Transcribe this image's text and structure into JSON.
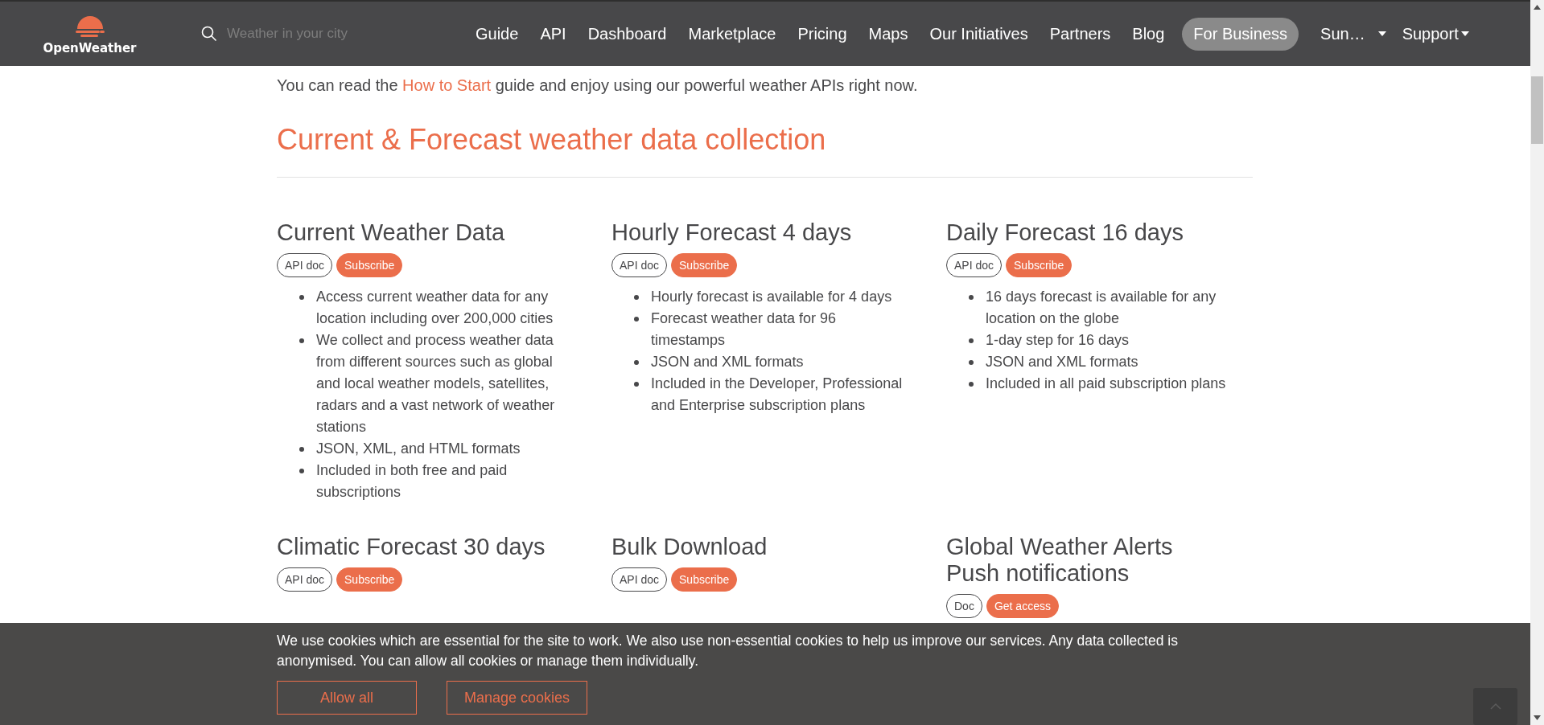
{
  "header": {
    "logo_text": "OpenWeather",
    "search": {
      "placeholder": "Weather in your city"
    },
    "nav": [
      {
        "label": "Guide",
        "kind": "link"
      },
      {
        "label": "API",
        "kind": "link"
      },
      {
        "label": "Dashboard",
        "kind": "link"
      },
      {
        "label": "Marketplace",
        "kind": "link"
      },
      {
        "label": "Pricing",
        "kind": "link"
      },
      {
        "label": "Maps",
        "kind": "link"
      },
      {
        "label": "Our Initiatives",
        "kind": "link"
      },
      {
        "label": "Partners",
        "kind": "link"
      },
      {
        "label": "Blog",
        "kind": "link"
      },
      {
        "label": "For Business",
        "kind": "pill"
      },
      {
        "label": "Sun…",
        "kind": "dropdown"
      },
      {
        "label": "Support",
        "kind": "dropdown"
      }
    ]
  },
  "intro": {
    "before": "You can read the",
    "link": "How to Start",
    "after": "guide and enjoy using our powerful weather APIs right now."
  },
  "section_title": "Current & Forecast weather data collection",
  "cards": [
    {
      "title": "Current Weather Data",
      "buttons": [
        {
          "label": "API doc",
          "kind": "outline"
        },
        {
          "label": "Subscribe",
          "kind": "filled"
        }
      ],
      "bullets": [
        "Access current weather data for any location including over 200,000 cities",
        "We collect and process weather data from different sources such as global and local weather models, satellites, radars and a vast network of weather stations",
        "JSON, XML, and HTML formats",
        "Included in both free and paid subscriptions"
      ]
    },
    {
      "title": "Hourly Forecast 4 days",
      "buttons": [
        {
          "label": "API doc",
          "kind": "outline"
        },
        {
          "label": "Subscribe",
          "kind": "filled"
        }
      ],
      "bullets": [
        "Hourly forecast is available for 4 days",
        "Forecast weather data for 96 timestamps",
        "JSON and XML formats",
        "Included in the Developer, Professional and Enterprise subscription plans"
      ]
    },
    {
      "title": "Daily Forecast 16 days",
      "buttons": [
        {
          "label": "API doc",
          "kind": "outline"
        },
        {
          "label": "Subscribe",
          "kind": "filled"
        }
      ],
      "bullets": [
        "16 days forecast is available for any location on the globe",
        "1-day step for 16 days",
        "JSON and XML formats",
        "Included in all paid subscription plans"
      ]
    },
    {
      "title": "Climatic Forecast 30 days",
      "buttons": [
        {
          "label": "API doc",
          "kind": "outline"
        },
        {
          "label": "Subscribe",
          "kind": "filled"
        }
      ]
    },
    {
      "title": "Bulk Download",
      "buttons": [
        {
          "label": "API doc",
          "kind": "outline"
        },
        {
          "label": "Subscribe",
          "kind": "filled"
        }
      ]
    },
    {
      "title": "Global Weather Alerts Push notifications",
      "buttons": [
        {
          "label": "Doc",
          "kind": "outline"
        },
        {
          "label": "Get access",
          "kind": "filled"
        }
      ]
    }
  ],
  "cookie_banner": {
    "text": "We use cookies which are essential for the site to work. We also use non-essential cookies to help us improve our services. Any data collected is anonymised. You can allow all cookies or manage them individually.",
    "buttons": [
      "Allow all",
      "Manage cookies"
    ]
  }
}
